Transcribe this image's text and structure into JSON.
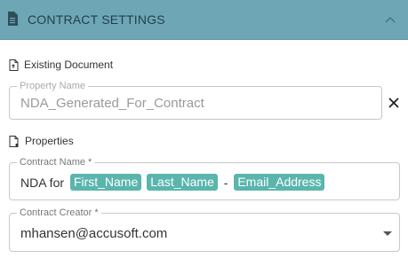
{
  "header": {
    "title": "CONTRACT SETTINGS"
  },
  "existing_document": {
    "label": "Existing Document",
    "property_name_legend": "Property Name",
    "property_name_value": "NDA_Generated_For_Contract"
  },
  "properties": {
    "label": "Properties",
    "contract_name_legend": "Contract Name *",
    "contract_name_prefix": "NDA for ",
    "tokens": [
      "First_Name",
      "Last_Name",
      "Email_Address"
    ],
    "separator": " - ",
    "contract_creator_legend": "Contract Creator *",
    "contract_creator_value": "mhansen@accusoft.com"
  },
  "colors": {
    "header_bg": "#6fa6b6",
    "chip_bg": "#5ab5ad"
  },
  "icons": {
    "header": "document-icon",
    "collapse": "chevron-up-icon",
    "clear": "close-icon"
  }
}
